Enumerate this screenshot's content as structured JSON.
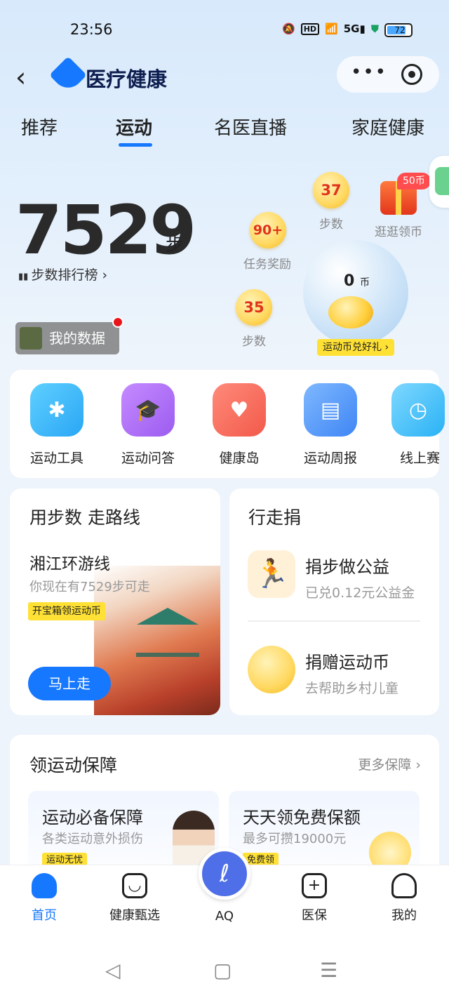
{
  "status": {
    "time": "23:56",
    "battery": "72"
  },
  "header": {
    "title": "医疗健康"
  },
  "tabs": [
    "推荐",
    "运动",
    "名医直播",
    "家庭健康"
  ],
  "steps": {
    "count": "7529",
    "unit": "步",
    "rank": "步数排行榜 ›",
    "mydata": "我的数据"
  },
  "coins": {
    "c1": {
      "value": "37",
      "label": "步数"
    },
    "c2": {
      "value": "90+",
      "label": "任务奖励"
    },
    "c3": {
      "value": "35",
      "label": "步数"
    },
    "gift_badge": "50币",
    "gift_label": "逛逛领币",
    "balance": "0",
    "balance_unit": "币",
    "exchange": "运动币兑好礼 ›"
  },
  "tools": [
    "运动工具",
    "运动问答",
    "健康岛",
    "运动周报",
    "线上赛"
  ],
  "route": {
    "title": "用步数 走路线",
    "name": "湘江环游线",
    "note": "你现在有7529步可走",
    "tag": "开宝箱领运动币",
    "button": "马上走"
  },
  "walk": {
    "title": "行走捐",
    "item1": {
      "name": "捐步做公益",
      "sub": "已兑0.12元公益金"
    },
    "item2": {
      "name": "捐赠运动币",
      "sub": "去帮助乡村儿童"
    }
  },
  "insure": {
    "title": "领运动保障",
    "more": "更多保障 ›",
    "box1": {
      "title": "运动必备保障",
      "sub": "各类运动意外损伤",
      "tag": "运动无忧"
    },
    "box2": {
      "title": "天天领免费保额",
      "sub": "最多可攒19000元",
      "tag": "免费领"
    }
  },
  "tabbar": [
    "首页",
    "健康甄选",
    "AQ",
    "医保",
    "我的"
  ],
  "nav": {
    "back": "◁",
    "home": "▢",
    "menu": "☰"
  }
}
